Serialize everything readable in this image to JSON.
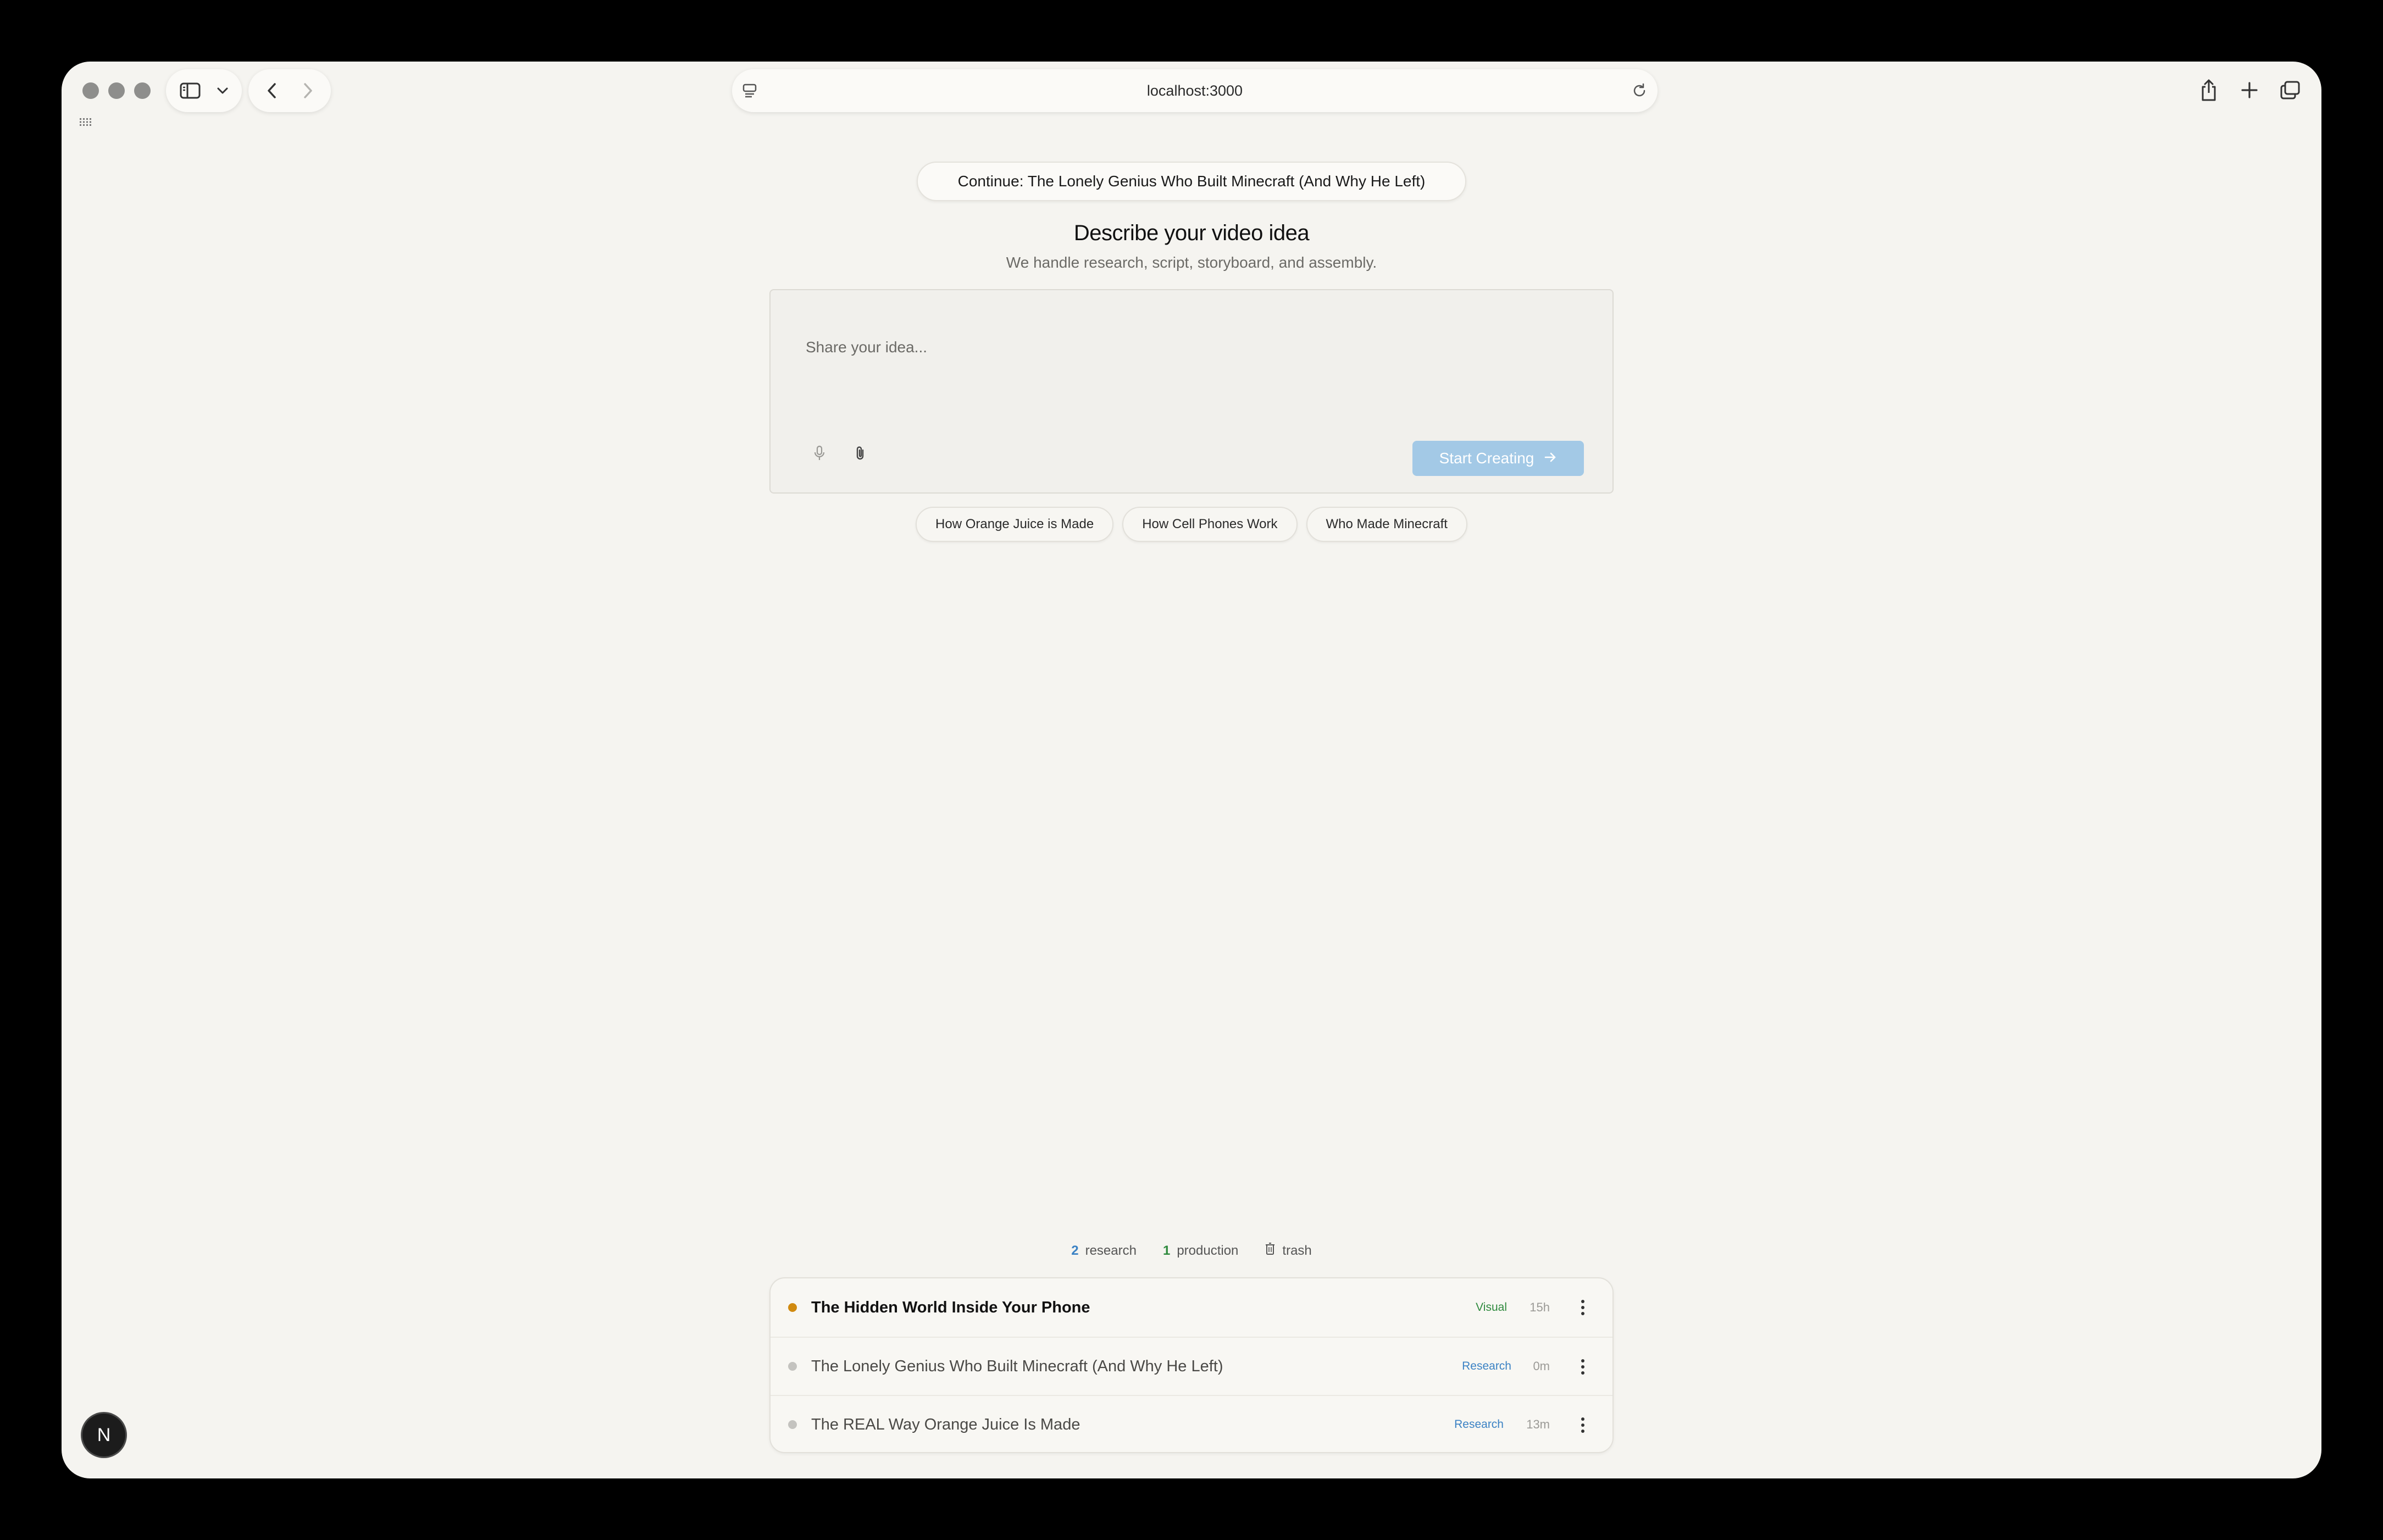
{
  "browser": {
    "url": "localhost:3000"
  },
  "main": {
    "continue_label": "Continue: The Lonely Genius Who Built Minecraft (And Why He Left)",
    "heading": "Describe your video idea",
    "subheading": "We handle research, script, storyboard, and assembly.",
    "input_placeholder": "Share your idea...",
    "start_button_label": "Start Creating",
    "suggestions": [
      "How Orange Juice is Made",
      "How Cell Phones Work",
      "Who Made Minecraft"
    ]
  },
  "stats": {
    "research_count": "2",
    "research_label": "research",
    "production_count": "1",
    "production_label": "production",
    "trash_label": "trash"
  },
  "projects": [
    {
      "title": "The Hidden World Inside Your Phone",
      "stage": "Visual",
      "age": "15h",
      "active": true
    },
    {
      "title": "The Lonely Genius Who Built Minecraft (And Why He Left)",
      "stage": "Research",
      "age": "0m",
      "active": false
    },
    {
      "title": "The REAL Way Orange Juice Is Made",
      "stage": "Research",
      "age": "13m",
      "active": false
    }
  ],
  "colors": {
    "visual_badge": "#2f8a3e",
    "research_badge": "#3b82c4",
    "active_dot": "#d08a10",
    "inactive_dot": "#c4c3bf",
    "start_button": "#a3c9e6"
  },
  "dev_badge_label": "N"
}
